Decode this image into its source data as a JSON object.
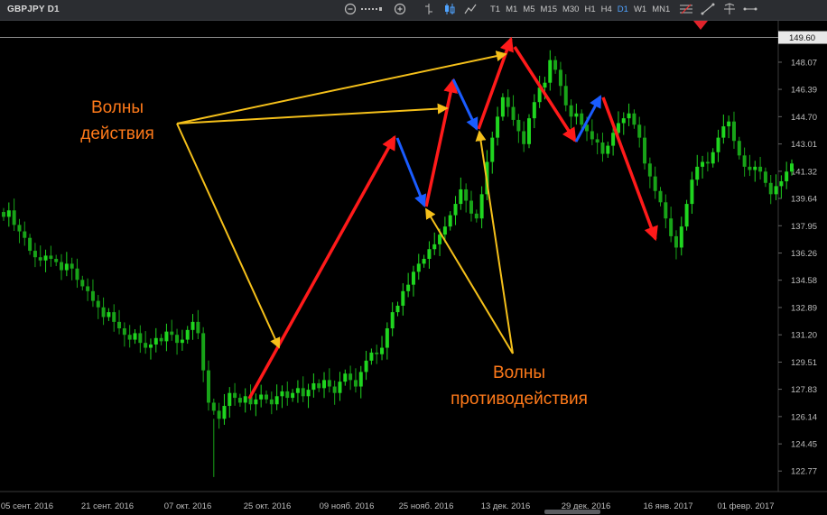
{
  "toolbar": {
    "symbol": "GBPJPY D1",
    "timeframes": [
      "T1",
      "M1",
      "M5",
      "M15",
      "M30",
      "H1",
      "H4",
      "D1",
      "W1",
      "MN1"
    ],
    "active_timeframe": "D1",
    "icons": [
      "zoom-out-icon",
      "zoom-slider-icon",
      "zoom-in-icon",
      "bar-chart-icon",
      "candlestick-icon",
      "line-chart-icon",
      "fibonacci-icon",
      "trendline-icon",
      "crosshair-icon",
      "horizontal-line-icon"
    ]
  },
  "chart": {
    "current_price": "149.60",
    "price_labels": [
      "148.07",
      "146.39",
      "144.70",
      "143.01",
      "141.32",
      "139.64",
      "137.95",
      "136.26",
      "134.58",
      "132.89",
      "131.20",
      "129.51",
      "127.83",
      "126.14",
      "124.45",
      "122.77"
    ],
    "date_labels": [
      "05 сент. 2016",
      "21 сент. 2016",
      "07 окт. 2016",
      "25 окт. 2016",
      "09 нояб. 2016",
      "25 нояб. 2016",
      "13 дек. 2016",
      "29 дек. 2016",
      "16 янв. 2017",
      "01 февр. 2017"
    ],
    "annotations": {
      "action_waves": "Волны\nдействия",
      "counter_waves": "Волны\nпротиводействия"
    },
    "colors": {
      "bull_candle": "#1fd51f",
      "bear_candle": "#18a318",
      "impulse_arrow": "#ff1a1a",
      "correction_arrow": "#1a5cff",
      "pointer_arrow": "#f5c01a",
      "annotation_text": "#ff7a1a"
    }
  },
  "chart_data": {
    "type": "candlestick",
    "title": "GBPJPY D1",
    "ylim": [
      121.5,
      150.3
    ],
    "grid": false,
    "closes": [
      138.5,
      138.9,
      138.0,
      137.6,
      137.2,
      136.4,
      136.0,
      135.8,
      136.1,
      135.9,
      135.7,
      135.2,
      135.6,
      135.3,
      134.6,
      134.2,
      133.9,
      133.3,
      132.9,
      132.3,
      132.6,
      132.0,
      131.6,
      131.2,
      130.9,
      131.3,
      130.7,
      130.4,
      130.6,
      131.0,
      130.8,
      131.4,
      131.2,
      130.7,
      130.9,
      131.5,
      132.0,
      131.3,
      129.0,
      127.0,
      126.5,
      126.0,
      126.8,
      127.6,
      127.3,
      127.0,
      127.4,
      126.9,
      127.2,
      127.5,
      127.2,
      126.9,
      127.4,
      127.7,
      127.3,
      127.6,
      127.9,
      127.4,
      127.8,
      128.2,
      127.9,
      128.4,
      128.0,
      127.6,
      128.3,
      128.8,
      128.4,
      128.0,
      128.9,
      129.6,
      130.1,
      130.0,
      130.4,
      131.6,
      132.6,
      133.0,
      133.9,
      134.3,
      135.1,
      135.6,
      135.9,
      136.5,
      136.8,
      137.4,
      137.9,
      138.6,
      139.3,
      140.2,
      139.5,
      138.7,
      138.4,
      139.9,
      141.9,
      143.4,
      144.7,
      145.9,
      145.3,
      144.5,
      143.8,
      143.0,
      144.6,
      145.6,
      146.5,
      146.8,
      148.2,
      147.6,
      146.6,
      145.4,
      144.7,
      144.9,
      144.2,
      143.8,
      143.3,
      143.1,
      142.4,
      142.9,
      143.7,
      144.3,
      144.6,
      144.9,
      144.2,
      143.4,
      141.8,
      141.0,
      140.1,
      139.4,
      138.4,
      137.3,
      136.6,
      137.9,
      139.3,
      140.8,
      141.6,
      141.9,
      141.8,
      142.5,
      143.4,
      144.1,
      144.4,
      143.2,
      142.3,
      141.6,
      141.4,
      141.6,
      141.3,
      140.6,
      139.9,
      140.4,
      140.7,
      141.3,
      141.8
    ]
  }
}
